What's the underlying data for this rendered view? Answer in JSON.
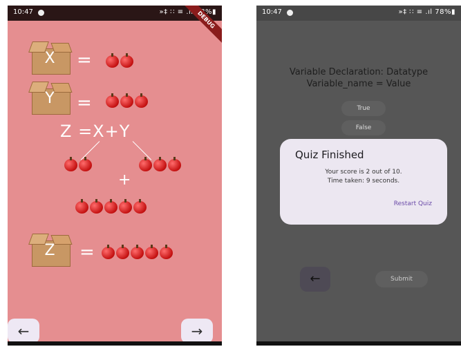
{
  "left_screen": {
    "status_time": "10:47",
    "status_icons": "»‡ ∷ ≡ .ıl 78%▮",
    "debug_banner": "DEBUG",
    "rows": [
      {
        "letter": "X",
        "equals": "=",
        "apple_count": 2
      },
      {
        "letter": "Y",
        "equals": "=",
        "apple_count": 3
      }
    ],
    "formula": "Z =X+Y",
    "plus": "+",
    "sum_left_apples": 2,
    "sum_right_apples": 3,
    "sum_total_apples": 5,
    "result": {
      "letter": "Z",
      "equals": "=",
      "apple_count": 5
    },
    "back_arrow": "←",
    "forward_arrow": "→"
  },
  "right_screen": {
    "status_time": "10:47",
    "status_icons": "»‡ ∷ ≡ .ıl 78%▮",
    "question_line1": "Variable Declaration: Datatype",
    "question_line2": "Variable_name = Value",
    "option_true": "True",
    "option_false": "False",
    "dialog": {
      "title": "Quiz Finished",
      "score_text": "Your score is 2 out of 10.",
      "time_text": "Time taken: 9 seconds.",
      "restart_label": "Restart Quiz"
    },
    "back_arrow": "←",
    "submit_label": "Submit"
  },
  "colors": {
    "left_bg": "#e58e90",
    "right_bg": "#565656",
    "dialog_bg": "#ece7f1",
    "accent": "#6a4aa8"
  }
}
